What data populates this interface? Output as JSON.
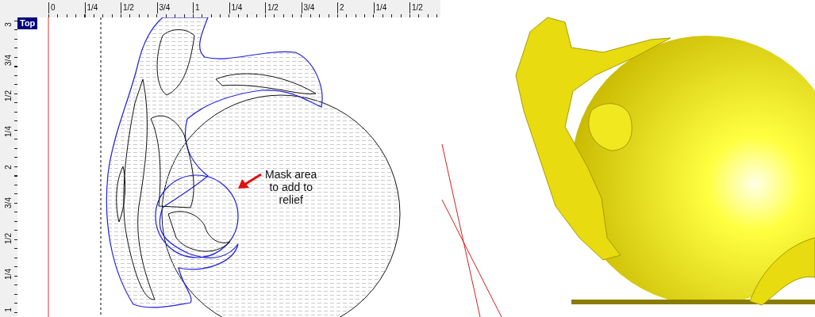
{
  "view_2d": {
    "view_label": "Top",
    "ruler_top": {
      "labels": [
        "0",
        "1/4",
        "1/2",
        "3/4",
        "1",
        "1/4",
        "1/2",
        "3/4",
        "2",
        "1/4",
        "1/2"
      ]
    },
    "ruler_left": {
      "labels": [
        "3",
        "3/4",
        "1/2",
        "1/4",
        "2",
        "3/4",
        "1/2",
        "1/4",
        "1"
      ]
    },
    "annotation": "Mask area\nto add to\nrelief"
  }
}
